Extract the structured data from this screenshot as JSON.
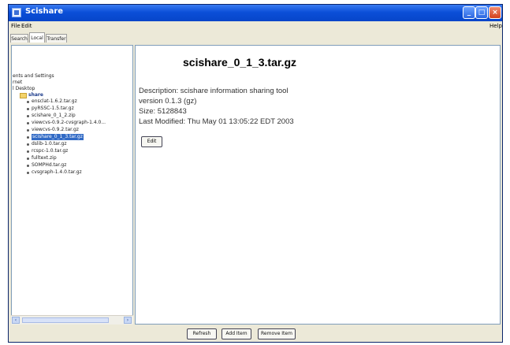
{
  "window": {
    "title": "Scishare"
  },
  "menu": {
    "file": "File",
    "edit": "Edit",
    "help": "Help"
  },
  "tabs": [
    "Search",
    "Local",
    "Transfer"
  ],
  "tree": {
    "root_items": [
      "ents and Settings",
      "rnet",
      "l Desktop"
    ],
    "folder": "share",
    "files": [
      "ensclat-1.6.2.tar.gz",
      "pyRSSC-1.5.tar.gz",
      "scishare_0_1_2.zip",
      "viewcvs-0.9.2-cvsgraph-1.4.0...",
      "viewcvs-0.9.2.tar.gz",
      "scishare_0_1_3.tar.gz",
      "dslib-1.0.tar.gz",
      "rcspc-1.0.tar.gz",
      "fulltext.zip",
      "SOMPHd.tar.gz",
      "cvsgraph-1.4.0.tar.gz"
    ],
    "selected_index": 5
  },
  "details": {
    "title": "scishare_0_1_3.tar.gz",
    "description": "Description: scishare information sharing tool",
    "version": "version 0.1.3 (gz)",
    "size": "Size: 5128843",
    "modified": "Last Modified: Thu May 01 13:05:22 EDT 2003",
    "edit_label": "Edit"
  },
  "buttons": {
    "refresh": "Refresh",
    "add": "Add Item",
    "remove": "Remove Item"
  }
}
